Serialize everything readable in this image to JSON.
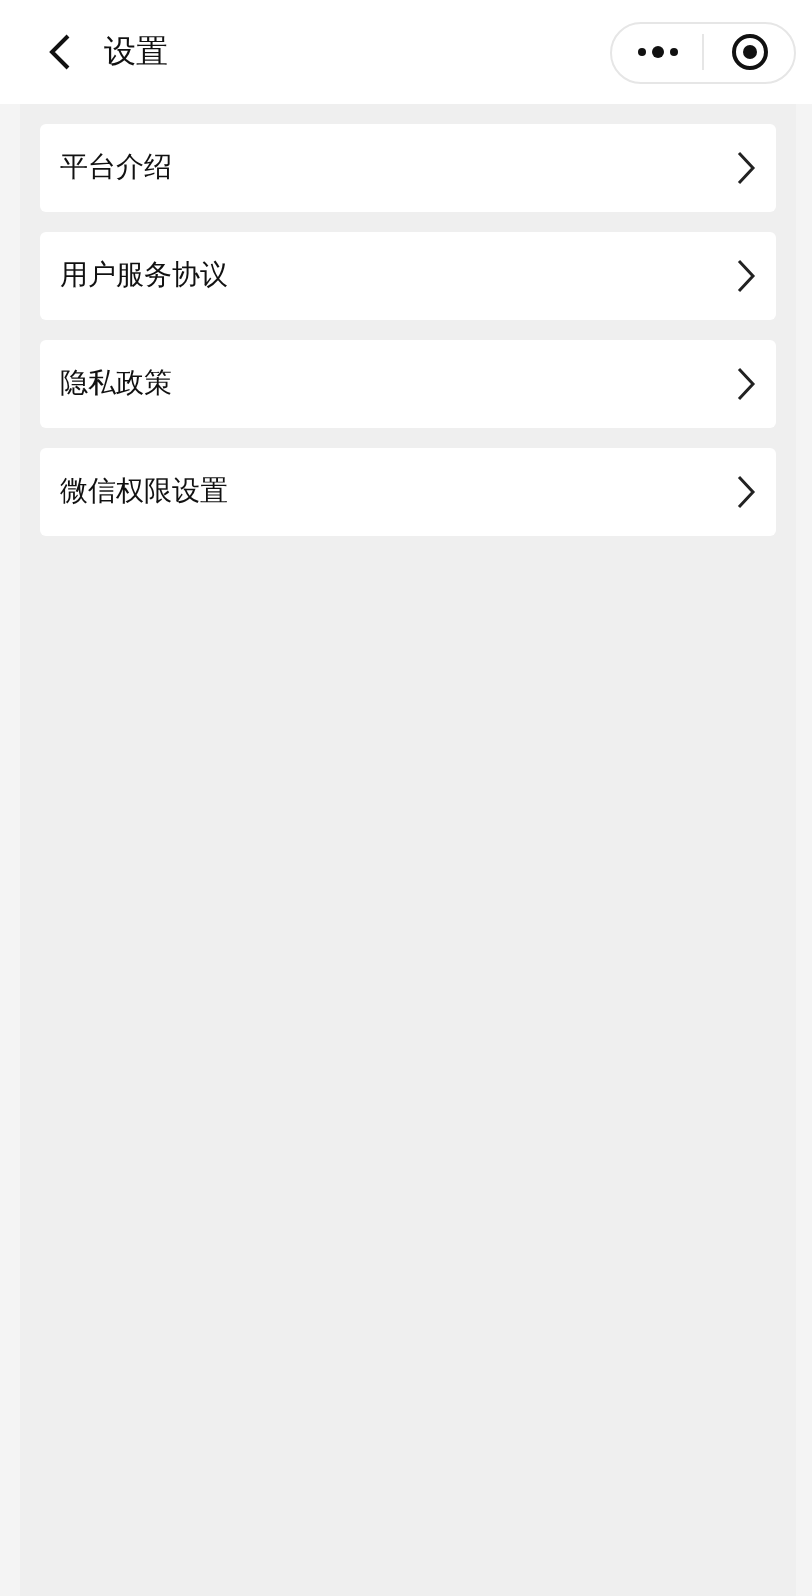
{
  "header": {
    "title": "设置"
  },
  "items": [
    {
      "label": "平台介绍"
    },
    {
      "label": "用户服务协议"
    },
    {
      "label": "隐私政策"
    },
    {
      "label": "微信权限设置"
    }
  ]
}
